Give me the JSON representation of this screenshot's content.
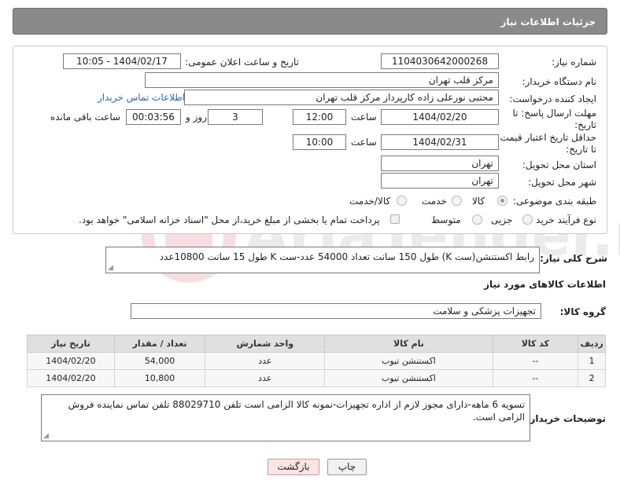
{
  "header": {
    "title": "جزئیات اطلاعات نیاز"
  },
  "form": {
    "need_number_label": "شماره نیاز:",
    "need_number": "1104030642000268",
    "announce_label": "تاریخ و ساعت اعلان عمومی:",
    "announce_value": "1404/02/17 - 10:05",
    "buyer_org_label": "نام دستگاه خریدار:",
    "buyer_org": "مرکز قلب تهران",
    "creator_label": "ایجاد کننده درخواست:",
    "creator": "مجتبی نورعلی زاده کارپرداز مرکز قلب تهران",
    "contact_link": "اطلاعات تماس خریدار",
    "reply_deadline_label": "مهلت ارسال پاسخ: تا تاریخ:",
    "reply_date": "1404/02/20",
    "time_label": "ساعت",
    "reply_time": "12:00",
    "days_value": "3",
    "days_label": "روز و",
    "remaining_time": "00:03:56",
    "remaining_label": "ساعت باقی مانده",
    "price_deadline_label": "حداقل تاریخ اعتبار قیمت: تا تاریخ:",
    "price_date": "1404/02/31",
    "price_time": "10:00",
    "province_label": "استان محل تحویل:",
    "province": "تهران",
    "city_label": "شهر محل تحویل:",
    "city": "تهران",
    "category_label": "طبقه بندی موضوعی:",
    "category_options": [
      "کالا",
      "خدمت",
      "کالا/خدمت"
    ],
    "purchase_type_label": "نوع فرآیند خرید :",
    "purchase_options": [
      "جزیی",
      "متوسط"
    ],
    "payment_note": "پرداخت تمام یا بخشی از مبلغ خرید،از محل \"اسناد خزانه اسلامی\" خواهد بود."
  },
  "summary": {
    "label": "شرح کلی نیاز:",
    "text": "رابط اکستنشن(ست K) طول 150 سانت تعداد 54000 عدد-ست K طول 15 سانت 10800عدد"
  },
  "goods": {
    "section_title": "اطلاعات کالاهای مورد نیاز",
    "group_label": "گروه کالا:",
    "group_value": "تجهیزات پزشکی و سلامت",
    "columns": [
      "ردیف",
      "کد کالا",
      "نام کالا",
      "واحد شمارش",
      "تعداد / مقدار",
      "تاریخ نیاز"
    ],
    "rows": [
      [
        "1",
        "--",
        "اکستنشن تیوب",
        "عدد",
        "54,000",
        "1404/02/20"
      ],
      [
        "2",
        "--",
        "اکستنشن تیوب",
        "عدد",
        "10,800",
        "1404/02/20"
      ]
    ]
  },
  "buyer_notes": {
    "label": "توضیحات خریدار:",
    "text": "تسویه 6 ماهه-دارای مجوز لازم از اداره تجهیزات-نمونه کالا الزامی است تلفن 88029710 تلفن تماس نماینده فروش الزامی است."
  },
  "buttons": {
    "print": "چاپ",
    "back": "بازگشت"
  },
  "watermark": {
    "brand": "AriaTender.net"
  },
  "colors": {
    "header_bg": "#8a8a8a",
    "link": "#2a6bbf",
    "back_button_bg": "#fbe4e4"
  }
}
